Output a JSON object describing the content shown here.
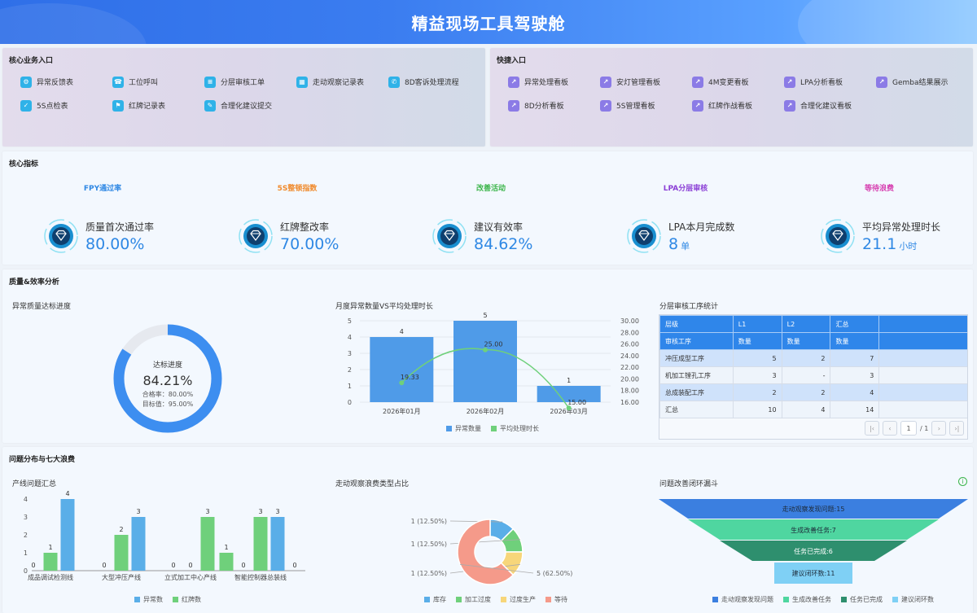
{
  "header": {
    "title": "精益现场工具驾驶舱"
  },
  "core_entry": {
    "title": "核心业务入口",
    "items": [
      {
        "label": "异常反馈表",
        "icon": "gear-icon"
      },
      {
        "label": "工位呼叫",
        "icon": "call-icon"
      },
      {
        "label": "分层审核工单",
        "icon": "hierarchy-icon"
      },
      {
        "label": "走动观察记录表",
        "icon": "building-icon"
      },
      {
        "label": "8D客诉处理流程",
        "icon": "support-icon"
      },
      {
        "label": "5S点检表",
        "icon": "checklist-icon"
      },
      {
        "label": "红牌记录表",
        "icon": "flag-icon"
      },
      {
        "label": "合理化建议提交",
        "icon": "suggestion-icon"
      }
    ]
  },
  "quick_entry": {
    "title": "快捷入口",
    "items": [
      {
        "label": "异常处理看板",
        "icon": "trend-chart-icon"
      },
      {
        "label": "安灯管理看板",
        "icon": "trend-chart-icon"
      },
      {
        "label": "4M变更看板",
        "icon": "trend-chart-icon"
      },
      {
        "label": "LPA分析看板",
        "icon": "trend-chart-icon"
      },
      {
        "label": "Gemba结果展示",
        "icon": "trend-chart-icon"
      },
      {
        "label": "8D分析看板",
        "icon": "trend-chart-icon"
      },
      {
        "label": "5S管理看板",
        "icon": "trend-chart-icon"
      },
      {
        "label": "红牌作战看板",
        "icon": "trend-chart-icon"
      },
      {
        "label": "合理化建议看板",
        "icon": "trend-chart-icon"
      }
    ]
  },
  "kpi": {
    "title": "核心指标",
    "tabs": [
      {
        "label": "FPY通过率",
        "color": "#2f88e4"
      },
      {
        "label": "5S整顿指数",
        "color": "#f08a2c"
      },
      {
        "label": "改善活动",
        "color": "#3bb54a"
      },
      {
        "label": "LPA分层审核",
        "color": "#8b3fd6"
      },
      {
        "label": "等待浪费",
        "color": "#d63fb0"
      }
    ],
    "cards": [
      {
        "name": "质量首次通过率",
        "value": "80.00%",
        "unit": ""
      },
      {
        "name": "红牌整改率",
        "value": "70.00%",
        "unit": ""
      },
      {
        "name": "建议有效率",
        "value": "84.62%",
        "unit": ""
      },
      {
        "name": "LPA本月完成数",
        "value": "8",
        "unit": "单"
      },
      {
        "name": "平均异常处理时长",
        "value": "21.1",
        "unit": "小时"
      }
    ]
  },
  "quality": {
    "title": "质量&效率分析",
    "donut": {
      "title": "异常质量达标进度",
      "center_label": "达标进度",
      "center_value": "84.21%",
      "pass_rate": "合格率：80.00%",
      "target": "目标值：95.00%",
      "progress": 0.8421,
      "color": "#3d8ef0",
      "track_color": "#e6e9ef"
    },
    "monthly_title": "月度异常数量VS平均处理时长",
    "audit": {
      "title": "分层审核工序统计",
      "head1": [
        "层级",
        "L1",
        "L2",
        "汇总"
      ],
      "head2": [
        "审核工序",
        "数量",
        "数量",
        "数量"
      ],
      "rows": [
        [
          "冲压成型工序",
          "5",
          "2",
          "7"
        ],
        [
          "机加工镗孔工序",
          "3",
          "-",
          "3"
        ],
        [
          "总成装配工序",
          "2",
          "2",
          "4"
        ],
        [
          "汇总",
          "10",
          "4",
          "14"
        ]
      ],
      "pager": {
        "first": "|‹",
        "prev": "‹",
        "page": "1",
        "total": "/ 1",
        "next": "›",
        "last": "›|"
      }
    }
  },
  "problems": {
    "title": "问题分布与七大浪费",
    "line_title": "产线问题汇总",
    "waste_title": "走动观察浪费类型占比",
    "funnel": {
      "title": "问题改善闭环漏斗",
      "info_icon": "i",
      "stages": [
        {
          "label": "走动观察发现问题:15",
          "legend": "走动观察发现问题",
          "value": 15,
          "color": "#3b7fe0"
        },
        {
          "label": "生成改善任务:7",
          "legend": "生成改善任务",
          "value": 7,
          "color": "#4fd6a0"
        },
        {
          "label": "任务已完成:6",
          "legend": "任务已完成",
          "value": 6,
          "color": "#2e8f6e"
        },
        {
          "label": "建议闭环数:11",
          "legend": "建议闭环数",
          "value": 11,
          "color": "#7fd0f5"
        }
      ]
    }
  },
  "chart_data": [
    {
      "type": "bar",
      "id": "monthly",
      "categories": [
        "2026年01月",
        "2026年02月",
        "2026年03月"
      ],
      "series": [
        {
          "name": "异常数量",
          "type": "bar",
          "axis": "left",
          "values": [
            4,
            5,
            1
          ],
          "color": "#4f9be8"
        },
        {
          "name": "平均处理时长",
          "type": "line",
          "axis": "right",
          "values": [
            19.33,
            25.0,
            15.0
          ],
          "color": "#6fd07b"
        }
      ],
      "ylim_left": [
        0,
        5
      ],
      "yticks_left": [
        "0",
        "1",
        "2",
        "3",
        "4",
        "5"
      ],
      "ylim_right": [
        16,
        30
      ],
      "yticks_right": [
        "16.00",
        "18.00",
        "20.00",
        "22.00",
        "24.00",
        "26.00",
        "28.00",
        "30.00"
      ],
      "data_labels_bar": [
        "4",
        "5",
        "1"
      ],
      "data_labels_line": [
        "19.33",
        "25.00",
        "15.00"
      ]
    },
    {
      "type": "bar",
      "id": "lines",
      "categories": [
        "成品调试检测线",
        "大型冲压产线",
        "立式加工中心产线",
        "智能控制器总装线"
      ],
      "series": [
        {
          "name": "异常数",
          "values": [
            0,
            0,
            0,
            3
          ],
          "color": "#5aaee8"
        },
        {
          "name": "红牌数",
          "values": [
            1,
            2,
            3,
            0
          ],
          "color": "#6fd07b"
        }
      ],
      "bar_groups": [
        [
          {
            "v": 0,
            "s": 0
          },
          {
            "v": 1,
            "s": 1
          },
          {
            "v": 4,
            "s": 0
          }
        ],
        [
          {
            "v": 0,
            "s": 0
          },
          {
            "v": 2,
            "s": 1
          },
          {
            "v": 3,
            "s": 0
          }
        ],
        [
          {
            "v": 0,
            "s": 0
          },
          {
            "v": 0,
            "s": 1
          },
          {
            "v": 3,
            "s": 1
          }
        ],
        [
          {
            "v": 1,
            "s": 1
          },
          {
            "v": 0,
            "s": 0
          },
          {
            "v": 3,
            "s": 1
          },
          {
            "v": 3,
            "s": 0
          },
          {
            "v": 0,
            "s": 0
          }
        ]
      ],
      "ylim": [
        0,
        4
      ],
      "yticks": [
        "0",
        "1",
        "2",
        "3",
        "4"
      ]
    },
    {
      "type": "pie",
      "id": "waste",
      "slices": [
        {
          "name": "库存",
          "value": 1,
          "label": "1 (12.50%)",
          "color": "#5aaee8"
        },
        {
          "name": "加工过度",
          "value": 1,
          "label": "1 (12.50%)",
          "color": "#6fd07b"
        },
        {
          "name": "过度生产",
          "value": 1,
          "label": "1 (12.50%)",
          "color": "#f7d67a"
        },
        {
          "name": "等待",
          "value": 5,
          "label": "5 (62.50%)",
          "color": "#f59a8a"
        }
      ]
    }
  ]
}
